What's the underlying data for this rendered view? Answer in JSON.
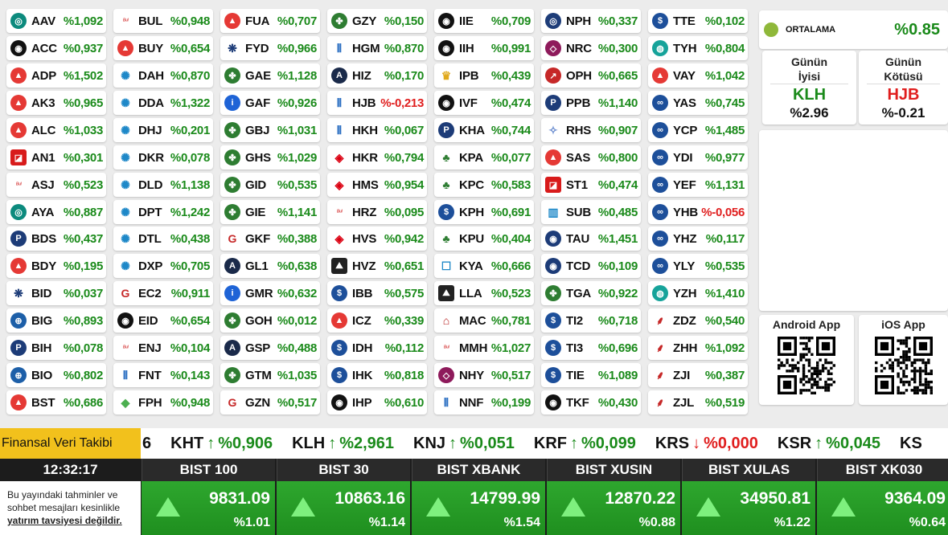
{
  "grid": [
    [
      {
        "t": "AAV",
        "v": "%1,092",
        "i": "ring-icon",
        "c": "#0c8a7d",
        "s": "circle"
      },
      {
        "t": "ACC",
        "v": "%0,937",
        "i": "swirl-icon",
        "c": "#111111",
        "s": "circle"
      },
      {
        "t": "ADP",
        "v": "%1,502",
        "i": "a-triangle-icon",
        "c": "#e53935",
        "s": "circle"
      },
      {
        "t": "AK3",
        "v": "%0,965",
        "i": "a-triangle-icon",
        "c": "#e53935",
        "s": "circle"
      },
      {
        "t": "ALC",
        "v": "%1,033",
        "i": "a-triangle-icon",
        "c": "#e53935",
        "s": "circle"
      },
      {
        "t": "AN1",
        "v": "%0,301",
        "i": "square-mark-icon",
        "c": "#d81b1b",
        "s": "square"
      },
      {
        "t": "ASJ",
        "v": "%0,523",
        "i": "script-logo-icon",
        "c": "#d84b4b",
        "s": "text"
      },
      {
        "t": "AYA",
        "v": "%0,887",
        "i": "ring-icon",
        "c": "#0c8a7d",
        "s": "circle"
      },
      {
        "t": "BDS",
        "v": "%0,437",
        "i": "p-logo-icon",
        "c": "#1d3c78",
        "s": "circle"
      },
      {
        "t": "BDY",
        "v": "%0,195",
        "i": "a-triangle-icon",
        "c": "#e53935",
        "s": "circle"
      },
      {
        "t": "BID",
        "v": "%0,037",
        "i": "sparkle-icon",
        "c": "#1d3c78",
        "s": "plain"
      },
      {
        "t": "BIG",
        "v": "%0,893",
        "i": "globe-icon",
        "c": "#1d5fa8",
        "s": "circle"
      },
      {
        "t": "BIH",
        "v": "%0,078",
        "i": "p-logo-icon",
        "c": "#1d3c78",
        "s": "circle"
      },
      {
        "t": "BIO",
        "v": "%0,802",
        "i": "globe-icon",
        "c": "#1d5fa8",
        "s": "circle"
      },
      {
        "t": "BST",
        "v": "%0,686",
        "i": "a-triangle-icon",
        "c": "#e53935",
        "s": "circle"
      }
    ],
    [
      {
        "t": "BUL",
        "v": "%0,948",
        "i": "script-logo-icon",
        "c": "#d84b4b",
        "s": "text"
      },
      {
        "t": "BUY",
        "v": "%0,654",
        "i": "a-triangle-icon",
        "c": "#e53935",
        "s": "circle"
      },
      {
        "t": "DAH",
        "v": "%0,870",
        "i": "gear-icon",
        "c": "#1e88c8",
        "s": "plain"
      },
      {
        "t": "DDA",
        "v": "%1,322",
        "i": "gear-icon",
        "c": "#1e88c8",
        "s": "plain"
      },
      {
        "t": "DHJ",
        "v": "%0,201",
        "i": "gear-icon",
        "c": "#1e88c8",
        "s": "plain"
      },
      {
        "t": "DKR",
        "v": "%0,078",
        "i": "gear-icon",
        "c": "#1e88c8",
        "s": "plain"
      },
      {
        "t": "DLD",
        "v": "%1,138",
        "i": "gear-icon",
        "c": "#1e88c8",
        "s": "plain"
      },
      {
        "t": "DPT",
        "v": "%1,242",
        "i": "gear-icon",
        "c": "#1e88c8",
        "s": "plain"
      },
      {
        "t": "DTL",
        "v": "%0,438",
        "i": "gear-icon",
        "c": "#1e88c8",
        "s": "plain"
      },
      {
        "t": "DXP",
        "v": "%0,705",
        "i": "gear-icon",
        "c": "#1e88c8",
        "s": "plain"
      },
      {
        "t": "EC2",
        "v": "%0,911",
        "i": "g-logo-icon",
        "c": "#c62828",
        "s": "plain"
      },
      {
        "t": "EID",
        "v": "%0,654",
        "i": "swirl-icon",
        "c": "#111111",
        "s": "circle"
      },
      {
        "t": "ENJ",
        "v": "%0,104",
        "i": "script-logo-icon",
        "c": "#d84b4b",
        "s": "text"
      },
      {
        "t": "FNT",
        "v": "%0,143",
        "i": "bars-icon",
        "c": "#2b6fc2",
        "s": "plain"
      },
      {
        "t": "FPH",
        "v": "%0,948",
        "i": "diamond-icon",
        "c": "#4caf50",
        "s": "plain"
      }
    ],
    [
      {
        "t": "FUA",
        "v": "%0,707",
        "i": "a-triangle-icon",
        "c": "#e53935",
        "s": "circle"
      },
      {
        "t": "FYD",
        "v": "%0,966",
        "i": "sparkle-icon",
        "c": "#1d3c78",
        "s": "plain"
      },
      {
        "t": "GAE",
        "v": "%1,128",
        "i": "clover-icon",
        "c": "#2e7d32",
        "s": "circle"
      },
      {
        "t": "GAF",
        "v": "%0,926",
        "i": "invesco-icon",
        "c": "#1e63d6",
        "s": "circle"
      },
      {
        "t": "GBJ",
        "v": "%1,031",
        "i": "clover-icon",
        "c": "#2e7d32",
        "s": "circle"
      },
      {
        "t": "GHS",
        "v": "%1,029",
        "i": "clover-icon",
        "c": "#2e7d32",
        "s": "circle"
      },
      {
        "t": "GID",
        "v": "%0,535",
        "i": "clover-icon",
        "c": "#2e7d32",
        "s": "circle"
      },
      {
        "t": "GIE",
        "v": "%1,141",
        "i": "clover-icon",
        "c": "#2e7d32",
        "s": "circle"
      },
      {
        "t": "GKF",
        "v": "%0,388",
        "i": "g-logo-icon",
        "c": "#c62828",
        "s": "plain"
      },
      {
        "t": "GL1",
        "v": "%0,638",
        "i": "a-dark-icon",
        "c": "#1a2a4a",
        "s": "circle"
      },
      {
        "t": "GMR",
        "v": "%0,632",
        "i": "invesco-icon",
        "c": "#1e63d6",
        "s": "circle"
      },
      {
        "t": "GOH",
        "v": "%0,012",
        "i": "clover-icon",
        "c": "#2e7d32",
        "s": "circle"
      },
      {
        "t": "GSP",
        "v": "%0,488",
        "i": "a-dark-icon",
        "c": "#1a2a4a",
        "s": "circle"
      },
      {
        "t": "GTM",
        "v": "%1,035",
        "i": "clover-icon",
        "c": "#2e7d32",
        "s": "circle"
      },
      {
        "t": "GZN",
        "v": "%0,517",
        "i": "g-logo-icon",
        "c": "#c62828",
        "s": "plain"
      }
    ],
    [
      {
        "t": "GZY",
        "v": "%0,150",
        "i": "clover-icon",
        "c": "#2e7d32",
        "s": "circle"
      },
      {
        "t": "HGM",
        "v": "%0,870",
        "i": "bars-icon",
        "c": "#2b6fc2",
        "s": "plain"
      },
      {
        "t": "HIZ",
        "v": "%0,170",
        "i": "a-dark-icon",
        "c": "#1a2a4a",
        "s": "circle"
      },
      {
        "t": "HJB",
        "v": "%-0,213",
        "i": "bars-icon",
        "c": "#2b6fc2",
        "s": "plain"
      },
      {
        "t": "HKH",
        "v": "%0,067",
        "i": "bars-icon",
        "c": "#2b6fc2",
        "s": "plain"
      },
      {
        "t": "HKR",
        "v": "%0,794",
        "i": "hsbc-icon",
        "c": "#db0011",
        "s": "plain"
      },
      {
        "t": "HMS",
        "v": "%0,954",
        "i": "hsbc-icon",
        "c": "#db0011",
        "s": "plain"
      },
      {
        "t": "HRZ",
        "v": "%0,095",
        "i": "script-logo-icon",
        "c": "#d84b4b",
        "s": "text"
      },
      {
        "t": "HVS",
        "v": "%0,942",
        "i": "hsbc-icon",
        "c": "#db0011",
        "s": "plain"
      },
      {
        "t": "HVZ",
        "v": "%0,651",
        "i": "mountain-icon",
        "c": "#222222",
        "s": "square"
      },
      {
        "t": "IBB",
        "v": "%0,575",
        "i": "dollar-icon",
        "c": "#1d4f9a",
        "s": "circle"
      },
      {
        "t": "ICZ",
        "v": "%0,339",
        "i": "a-triangle-icon",
        "c": "#e53935",
        "s": "circle"
      },
      {
        "t": "IDH",
        "v": "%0,112",
        "i": "dollar-icon",
        "c": "#1d4f9a",
        "s": "circle"
      },
      {
        "t": "IHK",
        "v": "%0,818",
        "i": "dollar-icon",
        "c": "#1d4f9a",
        "s": "circle"
      },
      {
        "t": "IHP",
        "v": "%0,610",
        "i": "swirl-icon",
        "c": "#111111",
        "s": "circle"
      }
    ],
    [
      {
        "t": "IIE",
        "v": "%0,709",
        "i": "swirl-icon",
        "c": "#111111",
        "s": "circle"
      },
      {
        "t": "IIH",
        "v": "%0,991",
        "i": "swirl-icon",
        "c": "#111111",
        "s": "circle"
      },
      {
        "t": "IPB",
        "v": "%0,439",
        "i": "crown-icon",
        "c": "#e0a81a",
        "s": "plain"
      },
      {
        "t": "IVF",
        "v": "%0,474",
        "i": "swirl-icon",
        "c": "#111111",
        "s": "circle"
      },
      {
        "t": "KHA",
        "v": "%0,744",
        "i": "p-logo-icon",
        "c": "#1d3c78",
        "s": "circle"
      },
      {
        "t": "KPA",
        "v": "%0,077",
        "i": "tree-icon",
        "c": "#2e7d32",
        "s": "plain"
      },
      {
        "t": "KPC",
        "v": "%0,583",
        "i": "tree-icon",
        "c": "#2e7d32",
        "s": "plain"
      },
      {
        "t": "KPH",
        "v": "%0,691",
        "i": "dollar-icon",
        "c": "#1d4f9a",
        "s": "circle"
      },
      {
        "t": "KPU",
        "v": "%0,404",
        "i": "tree-icon",
        "c": "#2e7d32",
        "s": "plain"
      },
      {
        "t": "KYA",
        "v": "%0,666",
        "i": "square-outline-icon",
        "c": "#1e88c8",
        "s": "plain"
      },
      {
        "t": "LLA",
        "v": "%0,523",
        "i": "mountain-icon",
        "c": "#222222",
        "s": "square"
      },
      {
        "t": "MAC",
        "v": "%0,781",
        "i": "bank-icon",
        "c": "#b71c1c",
        "s": "plain"
      },
      {
        "t": "MMH",
        "v": "%1,027",
        "i": "script-logo-icon",
        "c": "#d84b4b",
        "s": "text"
      },
      {
        "t": "NHY",
        "v": "%0,517",
        "i": "diamond-outline-icon",
        "c": "#8e1a5b",
        "s": "circle"
      },
      {
        "t": "NNF",
        "v": "%0,199",
        "i": "bars-icon",
        "c": "#2b6fc2",
        "s": "plain"
      }
    ],
    [
      {
        "t": "NPH",
        "v": "%0,337",
        "i": "target-icon",
        "c": "#1d3c78",
        "s": "circle"
      },
      {
        "t": "NRC",
        "v": "%0,300",
        "i": "diamond-outline-icon",
        "c": "#8e1a5b",
        "s": "circle"
      },
      {
        "t": "OPH",
        "v": "%0,665",
        "i": "chart-up-icon",
        "c": "#c62828",
        "s": "circle"
      },
      {
        "t": "PPB",
        "v": "%1,140",
        "i": "p-logo-icon",
        "c": "#1d3c78",
        "s": "circle"
      },
      {
        "t": "RHS",
        "v": "%0,907",
        "i": "spark-icon",
        "c": "#6a8ccf",
        "s": "plain"
      },
      {
        "t": "SAS",
        "v": "%0,800",
        "i": "a-triangle-icon",
        "c": "#e53935",
        "s": "circle"
      },
      {
        "t": "ST1",
        "v": "%0,474",
        "i": "square-mark-icon",
        "c": "#d81b1b",
        "s": "square"
      },
      {
        "t": "SUB",
        "v": "%0,485",
        "i": "chart-bar-icon",
        "c": "#1e88c8",
        "s": "plain"
      },
      {
        "t": "TAU",
        "v": "%1,451",
        "i": "eye-icon",
        "c": "#1d3c78",
        "s": "circle"
      },
      {
        "t": "TCD",
        "v": "%0,109",
        "i": "swirl-icon",
        "c": "#1d3c78",
        "s": "circle"
      },
      {
        "t": "TGA",
        "v": "%0,922",
        "i": "clover-icon",
        "c": "#2e7d32",
        "s": "circle"
      },
      {
        "t": "TI2",
        "v": "%0,718",
        "i": "dollar-icon",
        "c": "#1d4f9a",
        "s": "circle"
      },
      {
        "t": "TI3",
        "v": "%0,696",
        "i": "dollar-icon",
        "c": "#1d4f9a",
        "s": "circle"
      },
      {
        "t": "TIE",
        "v": "%1,089",
        "i": "dollar-icon",
        "c": "#1d4f9a",
        "s": "circle"
      },
      {
        "t": "TKF",
        "v": "%0,430",
        "i": "swirl-icon",
        "c": "#111111",
        "s": "circle"
      }
    ],
    [
      {
        "t": "TTE",
        "v": "%0,102",
        "i": "dollar-icon",
        "c": "#1d4f9a",
        "s": "circle"
      },
      {
        "t": "TYH",
        "v": "%0,804",
        "i": "globe-teal-icon",
        "c": "#16a39a",
        "s": "circle"
      },
      {
        "t": "VAY",
        "v": "%1,042",
        "i": "a-triangle-icon",
        "c": "#e53935",
        "s": "circle"
      },
      {
        "t": "YAS",
        "v": "%0,745",
        "i": "wave-icon",
        "c": "#1d4f9a",
        "s": "circle"
      },
      {
        "t": "YCP",
        "v": "%1,485",
        "i": "wave-icon",
        "c": "#1d4f9a",
        "s": "circle"
      },
      {
        "t": "YDI",
        "v": "%0,977",
        "i": "wave-icon",
        "c": "#1d4f9a",
        "s": "circle"
      },
      {
        "t": "YEF",
        "v": "%1,131",
        "i": "wave-icon",
        "c": "#1d4f9a",
        "s": "circle"
      },
      {
        "t": "YHB",
        "v": "%-0,056",
        "i": "wave-icon",
        "c": "#1d4f9a",
        "s": "circle"
      },
      {
        "t": "YHZ",
        "v": "%0,117",
        "i": "wave-icon",
        "c": "#1d4f9a",
        "s": "circle"
      },
      {
        "t": "YLY",
        "v": "%0,535",
        "i": "wave-icon",
        "c": "#1d4f9a",
        "s": "circle"
      },
      {
        "t": "YZH",
        "v": "%1,410",
        "i": "globe-teal-icon",
        "c": "#16a39a",
        "s": "circle"
      },
      {
        "t": "ZDZ",
        "v": "%0,540",
        "i": "wheat-icon",
        "c": "#c62828",
        "s": "plain"
      },
      {
        "t": "ZHH",
        "v": "%1,092",
        "i": "wheat-icon",
        "c": "#c62828",
        "s": "plain"
      },
      {
        "t": "ZJI",
        "v": "%0,387",
        "i": "wheat-icon",
        "c": "#c62828",
        "s": "plain"
      },
      {
        "t": "ZJL",
        "v": "%0,519",
        "i": "wheat-icon",
        "c": "#c62828",
        "s": "plain"
      }
    ]
  ],
  "colors": {
    "positive": "#1a8a1a",
    "negative": "#e01e1e",
    "ticker_label_bg": "#f2c11c",
    "index_box_bg": "#229922"
  },
  "average": {
    "label": "ORTALAMA",
    "value": "%0.85",
    "logo_icon": "fund-logo-icon"
  },
  "best": {
    "title_line1": "Günün",
    "title_line2": "İyisi",
    "code": "KLH",
    "pct": "%2.96",
    "code_color": "#1a8a1a"
  },
  "worst": {
    "title_line1": "Günün",
    "title_line2": "Kötüsü",
    "code": "HJB",
    "pct": "%-0.21",
    "code_color": "#e01e1e"
  },
  "apps": {
    "android_label": "Android App",
    "ios_label": "iOS App"
  },
  "ticker": {
    "label": "Finansal Veri Takibi",
    "items": [
      {
        "text": "6"
      },
      {
        "code": "KHT",
        "dir": "↑",
        "val": "%0,906",
        "color": "#1a8a1a"
      },
      {
        "code": "KLH",
        "dir": "↑",
        "val": "%2,961",
        "color": "#1a8a1a"
      },
      {
        "code": "KNJ",
        "dir": "↑",
        "val": "%0,051",
        "color": "#1a8a1a"
      },
      {
        "code": "KRF",
        "dir": "↑",
        "val": "%0,099",
        "color": "#1a8a1a"
      },
      {
        "code": "KRS",
        "dir": "↓",
        "val": "%0,000",
        "color": "#e01e1e"
      },
      {
        "code": "KSR",
        "dir": "↑",
        "val": "%0,045",
        "color": "#1a8a1a"
      },
      {
        "text": "KS"
      }
    ]
  },
  "clock": "12:32:17",
  "disclaimer": {
    "line1": "Bu yayındaki tahminler ve",
    "line2": "sohbet mesajları kesinlikle",
    "line3": "yatırım tavsiyesi değildir."
  },
  "indices": [
    {
      "name": "BIST 100",
      "value": "9831.09",
      "pct": "%1.01",
      "dir_icon": "triangle-up-icon"
    },
    {
      "name": "BIST 30",
      "value": "10863.16",
      "pct": "%1.14",
      "dir_icon": "triangle-up-icon"
    },
    {
      "name": "BIST XBANK",
      "value": "14799.99",
      "pct": "%1.54",
      "dir_icon": "triangle-up-icon"
    },
    {
      "name": "BIST XUSIN",
      "value": "12870.22",
      "pct": "%0.88",
      "dir_icon": "triangle-up-icon"
    },
    {
      "name": "BIST XULAS",
      "value": "34950.81",
      "pct": "%1.22",
      "dir_icon": "triangle-up-icon"
    },
    {
      "name": "BIST XK030",
      "value": "9364.09",
      "pct": "%0.64",
      "dir_icon": "triangle-up-icon"
    }
  ]
}
